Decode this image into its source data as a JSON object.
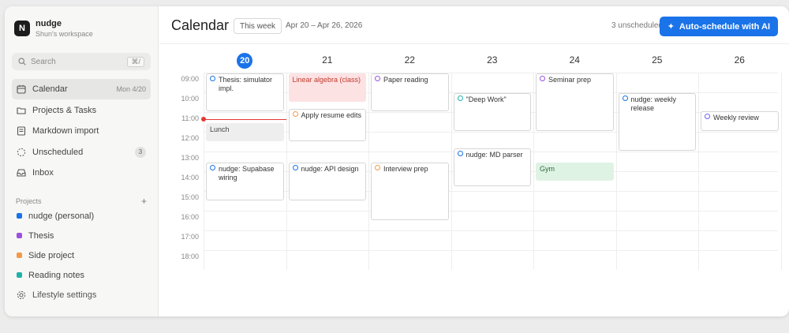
{
  "app": {
    "name": "nudge",
    "workspace": "Shun's workspace",
    "logo_glyph": "N"
  },
  "search": {
    "placeholder": "Search",
    "shortcut": "⌘/"
  },
  "nav": [
    {
      "icon": "calendar-icon",
      "label": "Calendar",
      "meta": "Mon 4/20",
      "active": true
    },
    {
      "icon": "folder-icon",
      "label": "Projects & Tasks"
    },
    {
      "icon": "import-icon",
      "label": "Markdown import"
    },
    {
      "icon": "dashed-circle-icon",
      "label": "Unscheduled",
      "badge": "3"
    },
    {
      "icon": "inbox-icon",
      "label": "Inbox"
    }
  ],
  "projects": {
    "header": "Projects",
    "add": "+",
    "items": [
      {
        "label": "nudge (personal)",
        "color": "#1a73e8"
      },
      {
        "label": "Thesis",
        "color": "#9b51e0"
      },
      {
        "label": "Side project",
        "color": "#f2994a"
      },
      {
        "label": "Reading notes",
        "color": "#20b2aa"
      }
    ]
  },
  "settings": {
    "icon": "gear-icon",
    "label": "Lifestyle settings"
  },
  "header": {
    "title": "Calendar",
    "range_chip": "This week",
    "range_text": "Apr 20 – Apr 26, 2026",
    "unscheduled": "3 unscheduled",
    "ai_button": "Auto-schedule with AI"
  },
  "days": [
    "20",
    "21",
    "22",
    "23",
    "24",
    "25",
    "26"
  ],
  "today_index": 0,
  "hours": [
    "09:00",
    "10:00",
    "11:00",
    "12:00",
    "13:00",
    "14:00",
    "15:00",
    "16:00",
    "17:00",
    "18:00"
  ],
  "now_time": "11:00",
  "events": [
    {
      "day": 0,
      "start": 9.0,
      "end": 11.0,
      "title": "Thesis: simulator impl.",
      "ring": "#1a73e8",
      "style": "task"
    },
    {
      "day": 0,
      "start": 11.5,
      "end": 12.5,
      "title": "Lunch",
      "style": "grey"
    },
    {
      "day": 0,
      "start": 13.5,
      "end": 15.5,
      "title": "nudge: Supabase wiring",
      "ring": "#1a73e8",
      "style": "task"
    },
    {
      "day": 1,
      "start": 9.0,
      "end": 10.5,
      "title": "Linear algebra (class)",
      "style": "pink"
    },
    {
      "day": 1,
      "start": 10.8,
      "end": 12.5,
      "title": "Apply resume edits",
      "ring": "#f2994a",
      "style": "task"
    },
    {
      "day": 1,
      "start": 13.5,
      "end": 15.5,
      "title": "nudge: API design",
      "ring": "#1a73e8",
      "style": "task"
    },
    {
      "day": 2,
      "start": 9.0,
      "end": 11.0,
      "title": "Paper reading",
      "ring": "#9b51e0",
      "style": "task"
    },
    {
      "day": 2,
      "start": 13.5,
      "end": 16.5,
      "title": "Interview prep",
      "ring": "#f2994a",
      "style": "task"
    },
    {
      "day": 3,
      "start": 10.0,
      "end": 12.0,
      "title": "\"Deep Work\"",
      "ring": "#20b2aa",
      "style": "task"
    },
    {
      "day": 3,
      "start": 12.8,
      "end": 14.8,
      "title": "nudge: MD parser",
      "ring": "#1a73e8",
      "style": "task"
    },
    {
      "day": 4,
      "start": 9.0,
      "end": 12.0,
      "title": "Seminar prep",
      "ring": "#9b51e0",
      "style": "task"
    },
    {
      "day": 4,
      "start": 13.5,
      "end": 14.5,
      "title": "Gym",
      "style": "green"
    },
    {
      "day": 5,
      "start": 10.0,
      "end": 13.0,
      "title": "nudge: weekly release",
      "ring": "#1a73e8",
      "style": "task"
    },
    {
      "day": 6,
      "start": 10.9,
      "end": 12.0,
      "title": "Weekly review",
      "ring": "#6c63ff",
      "style": "task"
    }
  ]
}
